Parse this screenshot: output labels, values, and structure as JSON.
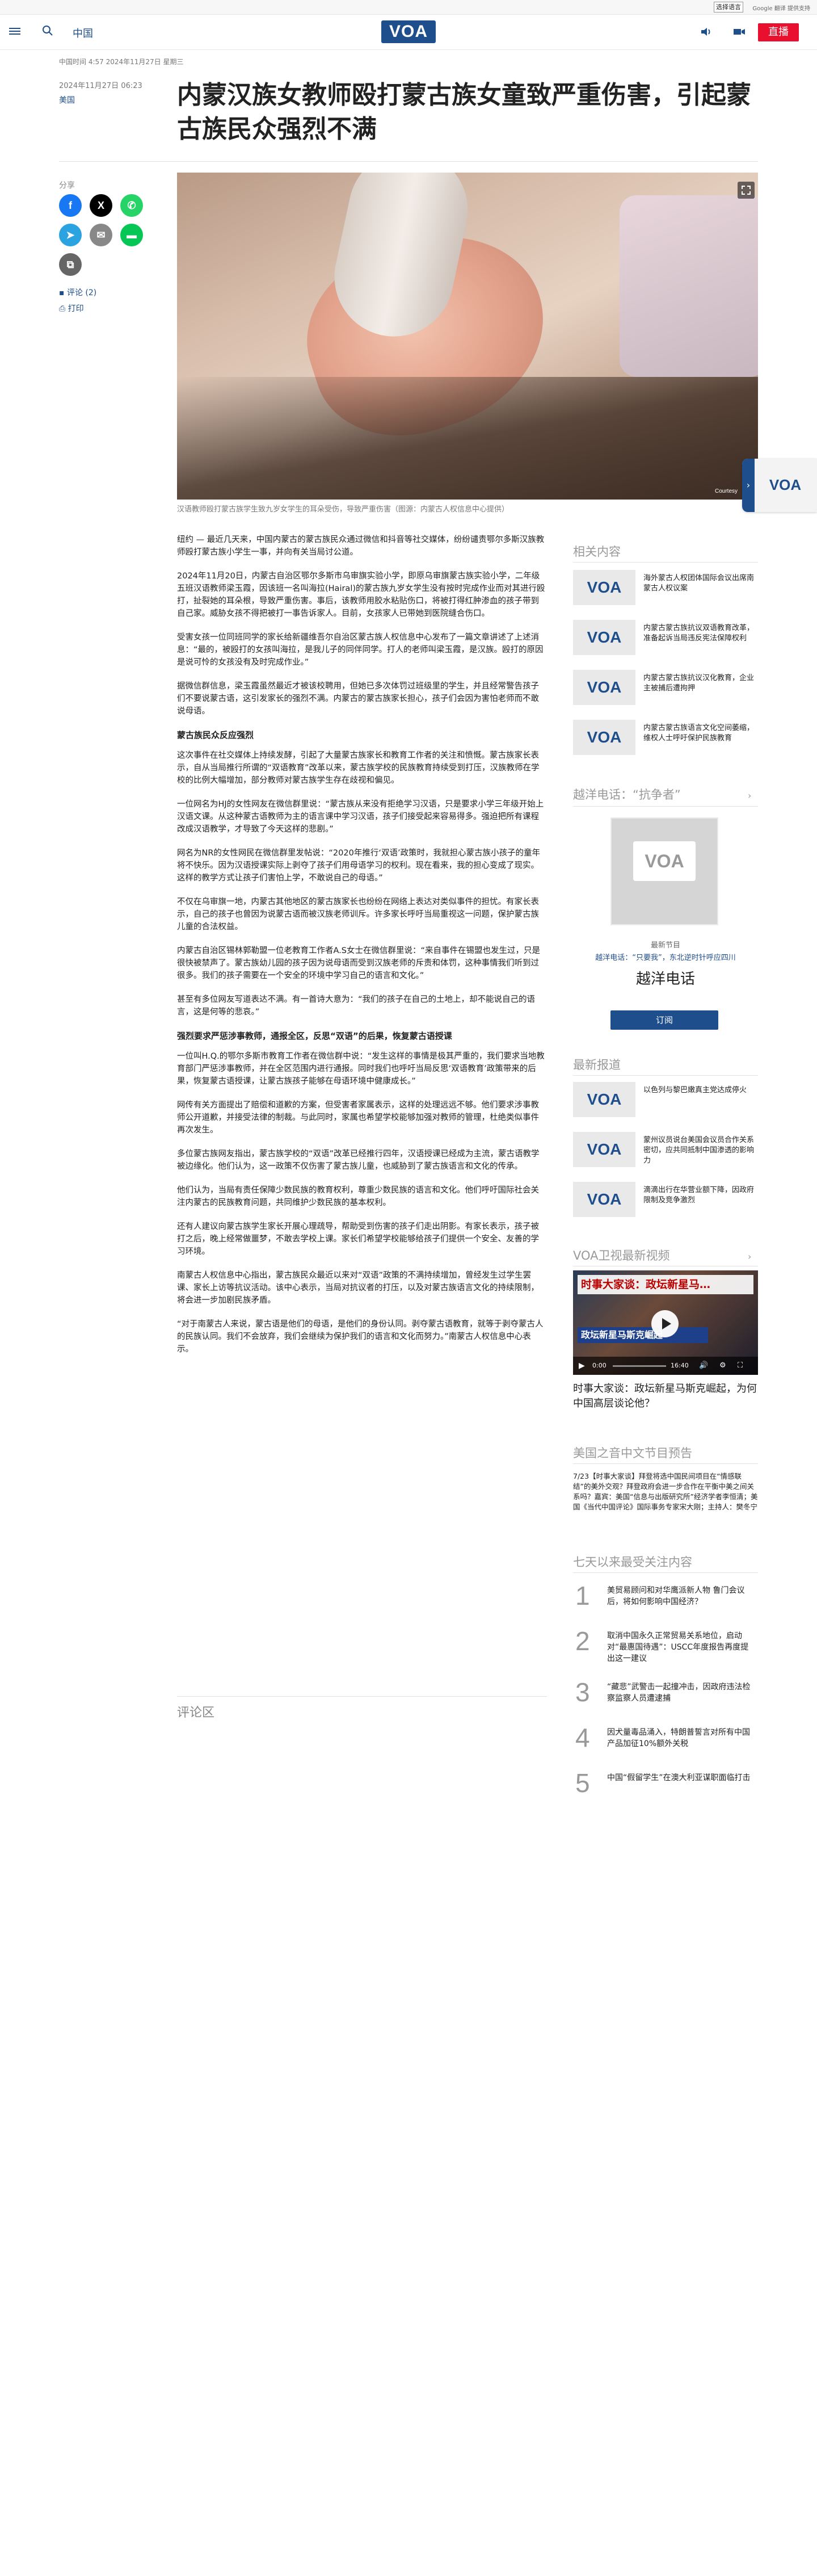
{
  "translate": {
    "select_label": "选择语言",
    "credit": "Google 翻译 提供支持"
  },
  "header": {
    "section": "中国",
    "logo": "VOA",
    "live": "直播"
  },
  "meta": {
    "china_time": "中国时间 4:57 2024年11月27日 星期三",
    "pub_date": "2024年11月27日 06:23",
    "category": "美国"
  },
  "article": {
    "title": "内蒙汉族女教师殴打蒙古族女童致严重伤害，引起蒙古族民众强烈不满",
    "share_label": "分享",
    "comments_link": "评论 (2)",
    "print_link": "打印",
    "caption": "汉语教师殴打蒙古族学生致九岁女学生的耳朵受伤，导致严重伤害（图源：内蒙古人权信息中心提供）",
    "hero_credit": "Courtesy",
    "paragraphs": [
      "纽约 — 最近几天来，中国内蒙古的蒙古族民众通过微信和抖音等社交媒体，纷纷谴责鄂尔多斯汉族教师殴打蒙古族小学生一事，并向有关当局讨公道。",
      "2024年11月20日，内蒙古自治区鄂尔多斯市乌审旗实验小学，即原乌审旗蒙古族实验小学，二年级五班汉语教师梁玉霞，因该班一名叫海拉(Hairal)的蒙古族九岁女学生没有按时完成作业而对其进行殴打，扯裂她的耳朵根，导致严重伤害。事后，该教师用胶水粘贴伤口，将被打得红肿渗血的孩子带到自己家。威胁女孩不得把被打一事告诉家人。目前，女孩家人已带她到医院缝合伤口。",
      "受害女孩一位同班同学的家长给新疆维吾尔自治区蒙古族人权信息中心发布了一篇文章讲述了上述消息：“最的，被殴打的女孩叫海拉，是我儿子的同伴同学。打人的老师叫梁玉霞，是汉族。殴打的原因是说可怜的女孩没有及时完成作业。”",
      "据微信群信息，梁玉霞虽然最近才被该校聘用，但她已多次体罚过班级里的学生，并且经常警告孩子们不要说蒙古语，这引发家长的强烈不满。内蒙古的蒙古族家长担心，孩子们会因为害怕老师而不敢说母语。",
      "蒙古族民众反应强烈",
      "这次事件在社交媒体上持续发酵，引起了大量蒙古族家长和教育工作者的关注和愤慨。蒙古族家长表示，自从当局推行所谓的“双语教育”改革以来，蒙古族学校的民族教育持续受到打压，汉族教师在学校的比例大幅增加，部分教师对蒙古族学生存在歧视和偏见。",
      "一位网名为HJ的女性网友在微信群里说：“蒙古族从来没有拒绝学习汉语，只是要求小学三年级开始上汉语文课。从这种蒙古语教师为主的语言课中学习汉语，孩子们接受起来容易得多。强迫把所有课程改成汉语教学，才导致了今天这样的悲剧。”",
      "网名为NR的女性网民在微信群里发帖说：“2020年推行‘双语’政策时，我就担心蒙古族小孩子的童年将不快乐。因为汉语授课实际上剥夺了孩子们用母语学习的权利。现在看来，我的担心变成了现实。这样的教学方式让孩子们害怕上学，不敢说自己的母语。”",
      "不仅在乌审旗一地，内蒙古其他地区的蒙古族家长也纷纷在网络上表达对类似事件的担忧。有家长表示，自己的孩子也曾因为说蒙古语而被汉族老师训斥。许多家长呼吁当局重视这一问题，保护蒙古族儿童的合法权益。",
      "内蒙古自治区锡林郭勒盟一位老教育工作者A.S女士在微信群里说：“来自事件在锡盟也发生过，只是很快被禁声了。蒙古族幼儿园的孩子因为说母语而受到汉族老师的斥责和体罚，这种事情我们听到过很多。我们的孩子需要在一个安全的环境中学习自己的语言和文化。”",
      "甚至有多位网友写道表达不满。有一首诗大意为：“我们的孩子在自己的土地上，却不能说自己的语言，这是何等的悲哀。”",
      "强烈要求严惩涉事教师，通报全区，反思“双语”的后果，恢复蒙古语授课",
      "一位叫H.Q.的鄂尔多斯市教育工作者在微信群中说：“发生这样的事情是极其严重的，我们要求当地教育部门严惩涉事教师，并在全区范围内进行通报。同时我们也呼吁当局反思‘双语教育’政策带来的后果，恢复蒙古语授课，让蒙古族孩子能够在母语环境中健康成长。”",
      "网传有关方面提出了赔偿和道歉的方案，但受害者家属表示，这样的处理远远不够。他们要求涉事教师公开道歉，并接受法律的制裁。与此同时，家属也希望学校能够加强对教师的管理，杜绝类似事件再次发生。",
      "多位蒙古族网友指出，蒙古族学校的“双语”改革已经推行四年，汉语授课已经成为主流，蒙古语教学被边缘化。他们认为，这一政策不仅伤害了蒙古族儿童，也威胁到了蒙古族语言和文化的传承。",
      "他们认为，当局有责任保障少数民族的教育权利，尊重少数民族的语言和文化。他们呼吁国际社会关注内蒙古的民族教育问题，共同维护少数民族的基本权利。",
      "还有人建议向蒙古族学生家长开展心理疏导，帮助受到伤害的孩子们走出阴影。有家长表示，孩子被打之后，晚上经常做噩梦，不敢去学校上课。家长们希望学校能够给孩子们提供一个安全、友善的学习环境。",
      "南蒙古人权信息中心指出，蒙古族民众最近以来对“双语”政策的不满持续增加，曾经发生过学生罢课、家长上访等抗议活动。该中心表示，当局对抗议者的打压，以及对蒙古族语言文化的持续限制，将会进一步加剧民族矛盾。",
      "“对于南蒙古人来说，蒙古语是他们的母语，是他们的身份认同。剥夺蒙古语教育，就等于剥夺蒙古人的民族认同。我们不会放弃，我们会继续为保护我们的语言和文化而努力。”南蒙古人权信息中心表示。"
    ],
    "comments_heading": "评论区"
  },
  "rail": {
    "related_heading": "相关内容",
    "related": [
      {
        "thumb": "VOA",
        "text": "海外蒙古人权团体国际会议出席南蒙古人权议案"
      },
      {
        "thumb": "VOA",
        "text": "内蒙古蒙古族抗议双语教育改革，准备起诉当局违反宪法保障权利"
      },
      {
        "thumb": "VOA",
        "text": "内蒙古蒙古族抗议汉化教育，企业主被捕后遭拘押"
      },
      {
        "thumb": "VOA",
        "text": "内蒙古蒙古族语言文化空间萎缩，维权人士呼吁保护民族教育"
      }
    ],
    "hotline_heading": "越洋电话：“抗争者”",
    "program_art": "VOA",
    "program_latest": "最新节目",
    "program_latest_title": "越洋电话：“只要我”，东北逆时针呼应四川",
    "program_name": "越洋电话",
    "subscribe": "订阅",
    "latest_heading": "最新报道",
    "latest": [
      {
        "thumb": "VOA",
        "text": "以色列与黎巴嫩真主党达成停火"
      },
      {
        "thumb": "VOA",
        "text": "蒙州议员说台美国会议员合作关系密切，应共同抵制中国渗透的影响力"
      },
      {
        "thumb": "VOA",
        "text": "滴滴出行在华营业额下降，因政府限制及竞争激烈"
      }
    ],
    "tv_heading": "VOA卫视最新视频",
    "video_banner_top": "时事大家谈：政坛新星马…",
    "video_banner_mid": "政坛新星马斯克崛起",
    "video_time_start": "0:00",
    "video_time_end": "16:40",
    "video_title": "时事大家谈：政坛新星马斯克崛起，为何中国高层谈论他？",
    "audio_heading": "美国之音中文节目预告",
    "audio_text": "7/23【时事大家谈】拜登将选中国民间项目在“情感联结”的美外交观？拜登政府会进一步合作在平衡中美之间关系吗？嘉宾：美国“信息与出版研究所”经济学者李恒清；美国《当代中国评论》国际事务专家宋大刚；主持人：樊冬宁",
    "popular_heading": "七天以来最受关注内容",
    "popular": [
      {
        "num": "1",
        "text": "美贸易顾问和对华鹰派新人物 鲁门会议后，将如何影响中国经济？"
      },
      {
        "num": "2",
        "text": "取消中国永久正常贸易关系地位，启动对“最惠国待遇”：USCC年度报告再度提出这一建议"
      },
      {
        "num": "3",
        "text": "“藏悲”武警击一起撞冲击，因政府违法检察监察人员遭逮捕"
      },
      {
        "num": "4",
        "text": "因犬量毒品涌入，特朗普誓言对所有中国产品加征10%额外关税"
      },
      {
        "num": "5",
        "text": "中国“假留学生”在澳大利亚谋职面临打击"
      }
    ]
  },
  "side_tab": {
    "logo": "VOA"
  },
  "colors": {
    "brand": "#1f4e8c",
    "live": "#e8102e",
    "muted": "#999999"
  }
}
